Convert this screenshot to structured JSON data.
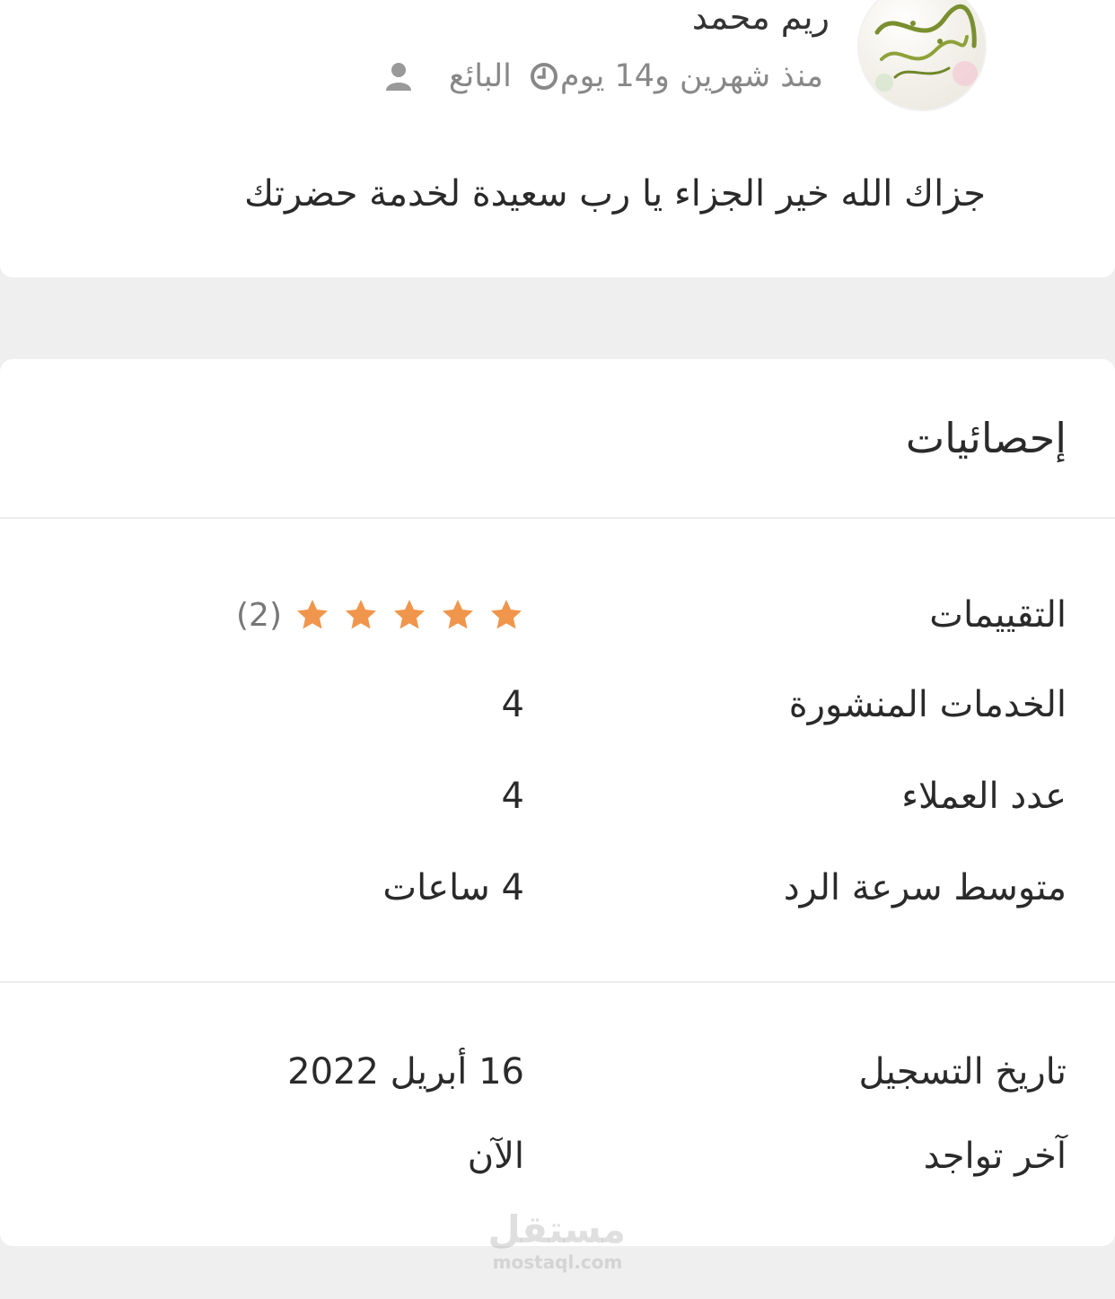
{
  "review": {
    "reviewer_name": "ريم محمد",
    "role": "البائع",
    "time_ago": "منذ شهرين و14 يوم",
    "text": "جزاك الله خير الجزاء يا رب سعيدة لخدمة حضرتك",
    "avatar_text": "اللهم وصل وسلم على نبينا"
  },
  "stats": {
    "title": "إحصائيات",
    "ratings_label": "التقييمات",
    "ratings_stars": 5,
    "ratings_count": "(2)",
    "services_label": "الخدمات المنشورة",
    "services_value": "4",
    "clients_label": "عدد العملاء",
    "clients_value": "4",
    "response_label": "متوسط سرعة الرد",
    "response_value": "4 ساعات",
    "registered_label": "تاريخ التسجيل",
    "registered_value": "16 أبريل 2022",
    "last_seen_label": "آخر تواجد",
    "last_seen_value": "الآن"
  },
  "watermark": {
    "main": "مستقل",
    "sub": "mostaql.com"
  },
  "icons": {
    "role": "user-icon",
    "time": "clock-icon",
    "star": "star-icon"
  },
  "colors": {
    "star": "#f0964c",
    "muted_text": "#888888",
    "background": "#efefef",
    "card": "#ffffff"
  }
}
